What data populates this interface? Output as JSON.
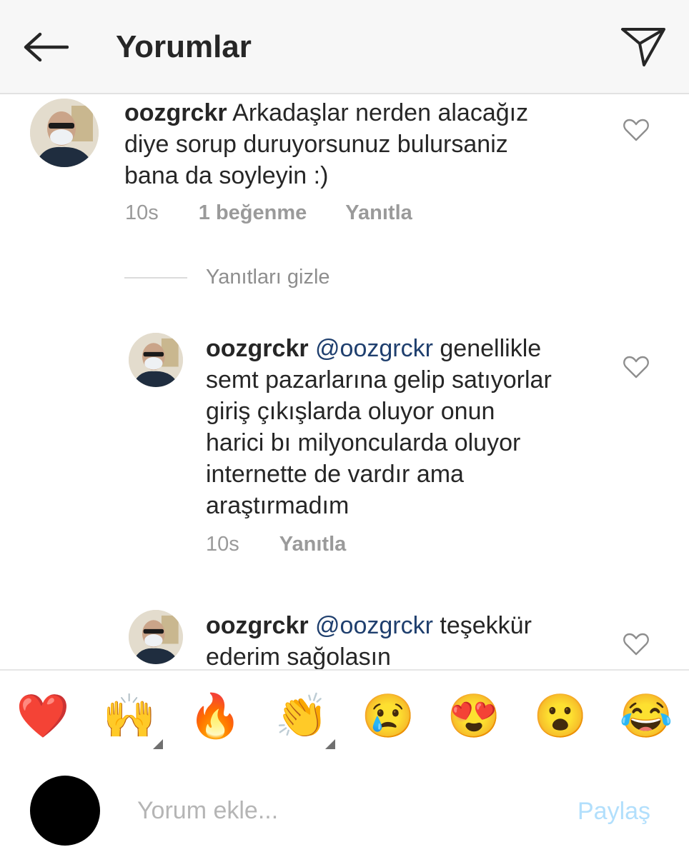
{
  "header": {
    "title": "Yorumlar"
  },
  "comments": [
    {
      "username": "oozgrckr",
      "text_lines": [
        "Arkadaşlar nerden alacağız",
        "diye sorup duruyorsunuz bulursaniz",
        "bana da soyleyin :)"
      ],
      "time": "10s",
      "likes": "1 beğenme",
      "reply_label": "Yanıtla"
    }
  ],
  "hide_replies_label": "Yanıtları gizle",
  "replies": [
    {
      "username": "oozgrckr",
      "mention": "@oozgrckr",
      "first_line_rest": "genellikle",
      "text_lines": [
        "semt pazarlarına gelip satıyorlar",
        "giriş çıkışlarda oluyor onun",
        "harici bı milyoncularda oluyor",
        "internette de vardır ama",
        "araştırmadım"
      ],
      "time": "10s",
      "reply_label": "Yanıtla"
    },
    {
      "username": "oozgrckr",
      "mention": "@oozgrckr",
      "first_line_rest": "teşekkür",
      "text_lines": [
        "ederim sağolasın"
      ]
    }
  ],
  "emoji_bar": [
    {
      "name": "red-heart-emoji",
      "glyph": "❤️"
    },
    {
      "name": "raising-hands-person-emoji",
      "glyph": "🙌"
    },
    {
      "name": "fire-emoji",
      "glyph": "🔥"
    },
    {
      "name": "clapping-hands-emoji",
      "glyph": "👏"
    },
    {
      "name": "crying-face-emoji",
      "glyph": "😢"
    },
    {
      "name": "heart-eyes-emoji",
      "glyph": "😍"
    },
    {
      "name": "surprised-face-emoji",
      "glyph": "😮"
    },
    {
      "name": "tears-of-joy-emoji",
      "glyph": "😂"
    }
  ],
  "composer": {
    "placeholder": "Yorum ekle...",
    "share_label": "Paylaş"
  },
  "colors": {
    "text": "#262626",
    "meta": "#9a9a9a",
    "mention": "#1f3f6e",
    "share_disabled": "#b2dffc"
  }
}
